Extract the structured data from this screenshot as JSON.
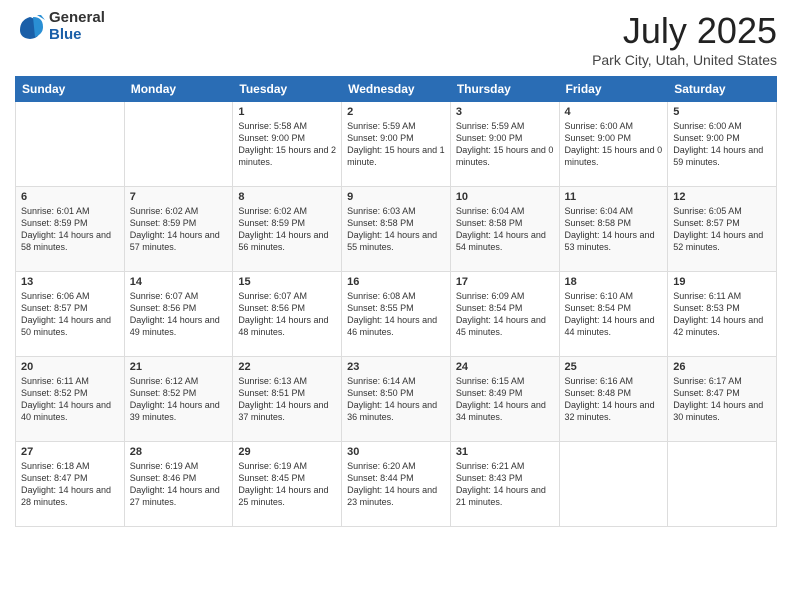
{
  "logo": {
    "general": "General",
    "blue": "Blue"
  },
  "title": "July 2025",
  "subtitle": "Park City, Utah, United States",
  "weekdays": [
    "Sunday",
    "Monday",
    "Tuesday",
    "Wednesday",
    "Thursday",
    "Friday",
    "Saturday"
  ],
  "weeks": [
    [
      {
        "day": "",
        "info": ""
      },
      {
        "day": "",
        "info": ""
      },
      {
        "day": "1",
        "info": "Sunrise: 5:58 AM\nSunset: 9:00 PM\nDaylight: 15 hours and 2 minutes."
      },
      {
        "day": "2",
        "info": "Sunrise: 5:59 AM\nSunset: 9:00 PM\nDaylight: 15 hours and 1 minute."
      },
      {
        "day": "3",
        "info": "Sunrise: 5:59 AM\nSunset: 9:00 PM\nDaylight: 15 hours and 0 minutes."
      },
      {
        "day": "4",
        "info": "Sunrise: 6:00 AM\nSunset: 9:00 PM\nDaylight: 15 hours and 0 minutes."
      },
      {
        "day": "5",
        "info": "Sunrise: 6:00 AM\nSunset: 9:00 PM\nDaylight: 14 hours and 59 minutes."
      }
    ],
    [
      {
        "day": "6",
        "info": "Sunrise: 6:01 AM\nSunset: 8:59 PM\nDaylight: 14 hours and 58 minutes."
      },
      {
        "day": "7",
        "info": "Sunrise: 6:02 AM\nSunset: 8:59 PM\nDaylight: 14 hours and 57 minutes."
      },
      {
        "day": "8",
        "info": "Sunrise: 6:02 AM\nSunset: 8:59 PM\nDaylight: 14 hours and 56 minutes."
      },
      {
        "day": "9",
        "info": "Sunrise: 6:03 AM\nSunset: 8:58 PM\nDaylight: 14 hours and 55 minutes."
      },
      {
        "day": "10",
        "info": "Sunrise: 6:04 AM\nSunset: 8:58 PM\nDaylight: 14 hours and 54 minutes."
      },
      {
        "day": "11",
        "info": "Sunrise: 6:04 AM\nSunset: 8:58 PM\nDaylight: 14 hours and 53 minutes."
      },
      {
        "day": "12",
        "info": "Sunrise: 6:05 AM\nSunset: 8:57 PM\nDaylight: 14 hours and 52 minutes."
      }
    ],
    [
      {
        "day": "13",
        "info": "Sunrise: 6:06 AM\nSunset: 8:57 PM\nDaylight: 14 hours and 50 minutes."
      },
      {
        "day": "14",
        "info": "Sunrise: 6:07 AM\nSunset: 8:56 PM\nDaylight: 14 hours and 49 minutes."
      },
      {
        "day": "15",
        "info": "Sunrise: 6:07 AM\nSunset: 8:56 PM\nDaylight: 14 hours and 48 minutes."
      },
      {
        "day": "16",
        "info": "Sunrise: 6:08 AM\nSunset: 8:55 PM\nDaylight: 14 hours and 46 minutes."
      },
      {
        "day": "17",
        "info": "Sunrise: 6:09 AM\nSunset: 8:54 PM\nDaylight: 14 hours and 45 minutes."
      },
      {
        "day": "18",
        "info": "Sunrise: 6:10 AM\nSunset: 8:54 PM\nDaylight: 14 hours and 44 minutes."
      },
      {
        "day": "19",
        "info": "Sunrise: 6:11 AM\nSunset: 8:53 PM\nDaylight: 14 hours and 42 minutes."
      }
    ],
    [
      {
        "day": "20",
        "info": "Sunrise: 6:11 AM\nSunset: 8:52 PM\nDaylight: 14 hours and 40 minutes."
      },
      {
        "day": "21",
        "info": "Sunrise: 6:12 AM\nSunset: 8:52 PM\nDaylight: 14 hours and 39 minutes."
      },
      {
        "day": "22",
        "info": "Sunrise: 6:13 AM\nSunset: 8:51 PM\nDaylight: 14 hours and 37 minutes."
      },
      {
        "day": "23",
        "info": "Sunrise: 6:14 AM\nSunset: 8:50 PM\nDaylight: 14 hours and 36 minutes."
      },
      {
        "day": "24",
        "info": "Sunrise: 6:15 AM\nSunset: 8:49 PM\nDaylight: 14 hours and 34 minutes."
      },
      {
        "day": "25",
        "info": "Sunrise: 6:16 AM\nSunset: 8:48 PM\nDaylight: 14 hours and 32 minutes."
      },
      {
        "day": "26",
        "info": "Sunrise: 6:17 AM\nSunset: 8:47 PM\nDaylight: 14 hours and 30 minutes."
      }
    ],
    [
      {
        "day": "27",
        "info": "Sunrise: 6:18 AM\nSunset: 8:47 PM\nDaylight: 14 hours and 28 minutes."
      },
      {
        "day": "28",
        "info": "Sunrise: 6:19 AM\nSunset: 8:46 PM\nDaylight: 14 hours and 27 minutes."
      },
      {
        "day": "29",
        "info": "Sunrise: 6:19 AM\nSunset: 8:45 PM\nDaylight: 14 hours and 25 minutes."
      },
      {
        "day": "30",
        "info": "Sunrise: 6:20 AM\nSunset: 8:44 PM\nDaylight: 14 hours and 23 minutes."
      },
      {
        "day": "31",
        "info": "Sunrise: 6:21 AM\nSunset: 8:43 PM\nDaylight: 14 hours and 21 minutes."
      },
      {
        "day": "",
        "info": ""
      },
      {
        "day": "",
        "info": ""
      }
    ]
  ]
}
